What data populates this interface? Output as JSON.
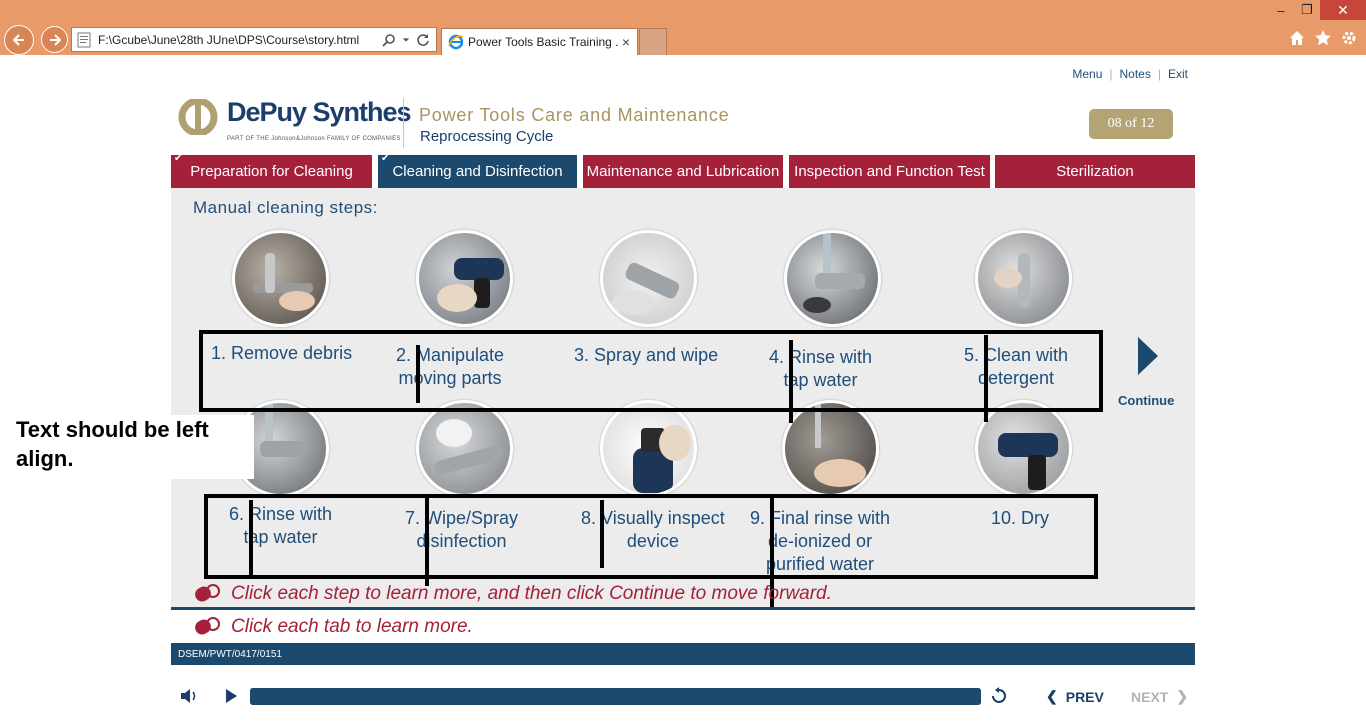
{
  "browser": {
    "url": "F:\\Gcube\\June\\28th JUne\\DPS\\Course\\story.html",
    "tab_title": "Power Tools Basic Training ...",
    "tab_close": "×",
    "window_controls": {
      "minimize": "–",
      "restore": "❐",
      "close": "✕"
    },
    "icons": [
      "back-icon",
      "forward-icon",
      "search-icon",
      "refresh-icon",
      "home-icon",
      "favorites-icon",
      "settings-icon"
    ]
  },
  "header": {
    "links": {
      "menu": "Menu",
      "notes": "Notes",
      "exit": "Exit"
    },
    "logo": {
      "name": "DePuy Synthes",
      "tagline": "PART OF THE Johnson&Johnson FAMILY OF COMPANIES"
    },
    "course_title": "Power Tools Care and Maintenance",
    "course_subtitle": "Reprocessing Cycle",
    "page_counter": "08 of 12"
  },
  "nav_tabs": [
    {
      "label": "Preparation for Cleaning",
      "completed": true,
      "active": false
    },
    {
      "label": "Cleaning and Disinfection",
      "completed": true,
      "active": true
    },
    {
      "label": "Maintenance and Lubrication",
      "completed": false,
      "active": false
    },
    {
      "label": "Inspection and Function Test",
      "completed": false,
      "active": false
    },
    {
      "label": "Sterilization",
      "completed": false,
      "active": false
    }
  ],
  "content": {
    "heading": "Manual cleaning steps:",
    "steps": [
      {
        "line1": "1. Remove debris",
        "line2": ""
      },
      {
        "line1": "2. Manipulate",
        "line2": "moving parts"
      },
      {
        "line1": "3. Spray and wipe",
        "line2": ""
      },
      {
        "line1": "4. Rinse with",
        "line2": "tap water"
      },
      {
        "line1": "5. Clean with",
        "line2": "detergent"
      },
      {
        "line1": "6. Rinse with",
        "line2": "tap water"
      },
      {
        "line1": "7. Wipe/Spray",
        "line2": "disinfection"
      },
      {
        "line1": "8. Visually inspect",
        "line2": "device"
      },
      {
        "line1": "9. Final rinse with",
        "line2": "de-ionized or",
        "line3": "purified water"
      },
      {
        "line1": "10. Dry",
        "line2": ""
      }
    ],
    "continue_label": "Continue",
    "annotation_note": "Text should be left align."
  },
  "instructions": {
    "line1": "Click each step to learn more, and then click Continue to move forward.",
    "line2": "Click each tab to learn more."
  },
  "footer": {
    "code": "DSEM/PWT/0417/0151"
  },
  "player": {
    "progress": 1.0,
    "prev_label": "PREV",
    "next_label": "NEXT"
  },
  "colors": {
    "chrome": "#e89a68",
    "maroon": "#a5213a",
    "navy": "#1b4a6e",
    "gold": "#b4a373",
    "panel": "#ececec"
  }
}
